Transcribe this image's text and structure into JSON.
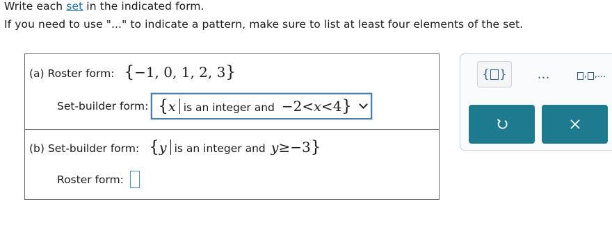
{
  "instructions": {
    "line1_before": "Write each ",
    "line1_link": "set",
    "line1_after": " in the indicated form.",
    "line2": "If you need to use \"...\" to indicate a pattern, make sure to list at least four elements of the set."
  },
  "part_a": {
    "label": "(a)  Roster form:",
    "roster_open": "{",
    "roster_values": "−1, 0, 1, 2, 3",
    "roster_close": "}",
    "setbuilder_label": "Set-builder form:",
    "selected": {
      "open": "{",
      "var": "x",
      "text": "is an integer and",
      "ineq_lhs": "−2",
      "lt1": "<",
      "var2": "x",
      "lt2": "<",
      "rhs": "4",
      "close": "}"
    }
  },
  "part_b": {
    "label": "(b)  Set-builder form:",
    "open": "{",
    "var": "y",
    "text": "is an integer and",
    "var2": "y",
    "ge": "≥",
    "rhs": "−3",
    "close": "}",
    "roster_label": "Roster form:"
  },
  "toolbar": {
    "set_open": "{",
    "set_close": "}",
    "dots": "…",
    "list_sep": ",",
    "list_tail": ",..."
  },
  "icons": [
    "set-braces-icon",
    "ellipsis-icon",
    "list-pattern-icon",
    "undo-icon",
    "close-icon",
    "chevron-down-icon"
  ],
  "colors": {
    "accent": "#1e7a8e",
    "link": "#1f6fb0",
    "select_border": "#4a7fa8",
    "answer_box": "#4a90d0"
  }
}
